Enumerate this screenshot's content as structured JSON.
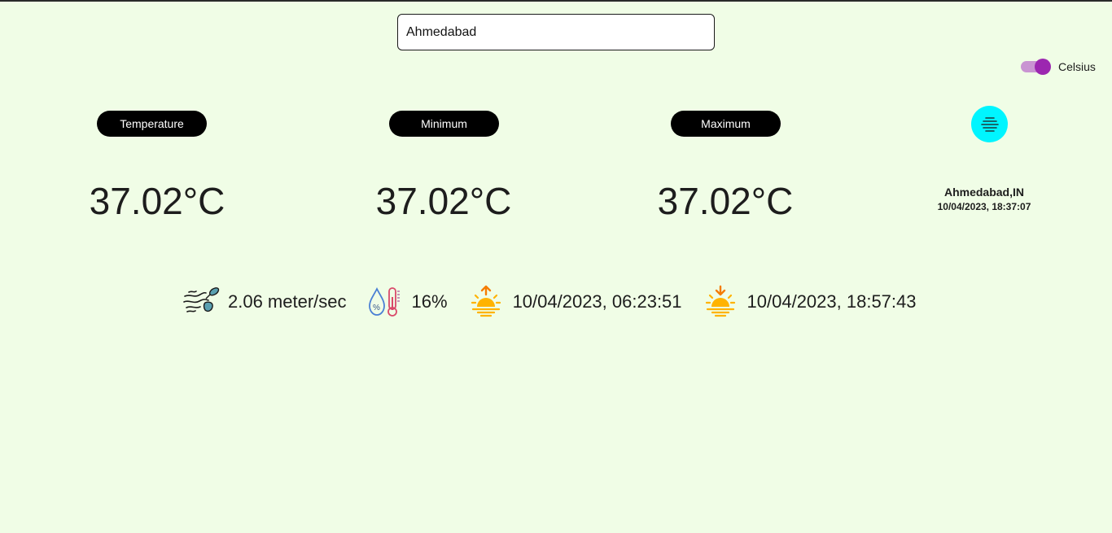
{
  "search": {
    "value": "Ahmedabad"
  },
  "unit_toggle": {
    "label": "Celsius",
    "on": true,
    "track_color": "#c994d2",
    "thumb_color": "#9c27b0"
  },
  "stats": [
    {
      "label": "Temperature",
      "value": "37.02°C"
    },
    {
      "label": "Minimum",
      "value": "37.02°C"
    },
    {
      "label": "Maximum",
      "value": "37.02°C"
    }
  ],
  "current": {
    "icon": "haze-icon",
    "badge_color": "#00f5ff",
    "location": "Ahmedabad,IN",
    "datetime": "10/04/2023, 18:37:07"
  },
  "details": {
    "wind": {
      "icon": "wind-icon",
      "text": "2.06 meter/sec"
    },
    "humidity": {
      "icon": "humidity-icon",
      "text": "16%"
    },
    "sunrise": {
      "icon": "sunrise-icon",
      "text": "10/04/2023, 06:23:51"
    },
    "sunset": {
      "icon": "sunset-icon",
      "text": "10/04/2023, 18:57:43"
    }
  },
  "colors": {
    "background": "#f0fde6",
    "pill": "#000000",
    "sun": "#ffb300",
    "sun_arrow": "#f57c00"
  }
}
